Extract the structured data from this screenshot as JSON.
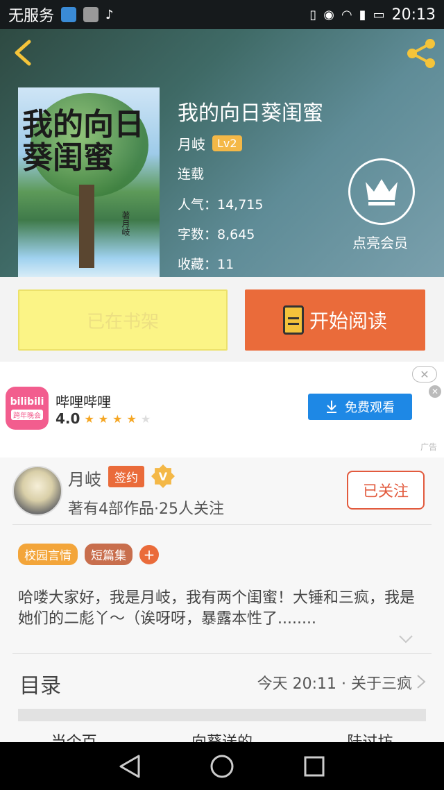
{
  "status_bar": {
    "carrier": "无服务",
    "time": "20:13"
  },
  "header": {
    "book_title": "我的向日葵闺蜜",
    "author": "月岐",
    "level": "Lv2",
    "status": "连载",
    "popularity": "人气：14,715",
    "word_count": "字数：8,645",
    "favorites": "收藏：11",
    "vip_label": "点亮会员",
    "cover_title": "我的向日葵闺蜜",
    "cover_author": "著月岐"
  },
  "actions": {
    "on_shelf": "已在书架",
    "start_reading": "开始阅读"
  },
  "ad": {
    "app_name": "哔哩哔哩",
    "logo_text": "bilibili",
    "logo_sub": "跨年晚会",
    "rating": "4.0",
    "cta": "免费观看",
    "tag": "广告"
  },
  "author_card": {
    "name": "月岐",
    "signed_badge": "签约",
    "v_badge": "V",
    "stats": "著有4部作品·25人关注",
    "follow_button": "已关注",
    "tags": [
      "校园言情",
      "短篇集"
    ],
    "add_tag": "+",
    "description": "哈喽大家好，我是月岐，我有两个闺蜜！大锤和三疯，我是她们的二彪丫～（诶呀呀，暴露本性了........"
  },
  "toc": {
    "title": "目录",
    "latest": "今天 20:11 · 关于三疯"
  },
  "bottom_tabs": [
    "当个百",
    "向葵送的",
    "陆过坊"
  ]
}
